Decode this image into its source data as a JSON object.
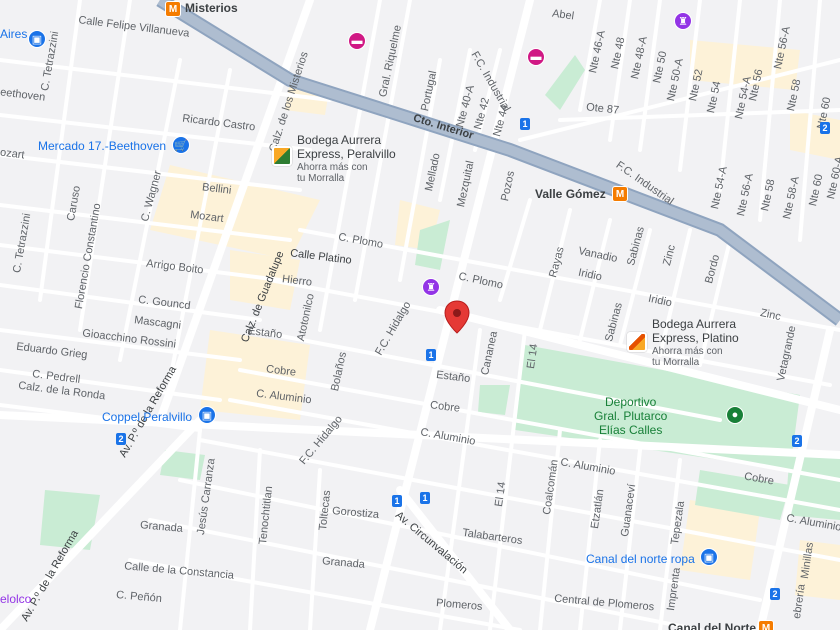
{
  "colors": {
    "background": "#f2f2f4",
    "block": "#fdf2d8",
    "park": "#c9ecd4",
    "road": "#ffffff",
    "highway": "#aebdd0",
    "pin": "#e53935",
    "metro": "#f57c00",
    "shield": "#1a73e8",
    "shopping": "#1a73e8",
    "hotel": "#d01884",
    "monument": "#9334e6",
    "park_icon": "#188038"
  },
  "places": {
    "misterios": "Misterios",
    "valle_gomez": "Valle Gómez",
    "mercado": "Mercado 17.-Beethoven",
    "bodega_peralvillo": [
      "Bodega Aurrera",
      "Express, Peralvillo"
    ],
    "bodega_peralvillo_sub": [
      "Ahorra más con",
      "tu Morralla"
    ],
    "bodega_platino": [
      "Bodega Aurrera",
      "Express, Platino"
    ],
    "bodega_platino_sub": [
      "Ahorra más con",
      "tu Morralla"
    ],
    "deportivo": [
      "Deportivo",
      "Gral. Plutarco",
      "Elías Calles"
    ],
    "coppel": "Coppel Peralvillo",
    "canal_norte_ropa": "Canal del norte ropa",
    "canal_del_norte": "Canal del Norte",
    "aires": "Aires",
    "belolco": "elolco"
  },
  "streets": {
    "felipe_villanueva": "Calle Felipe Villanueva",
    "tetrazzini_top": "C. Tetrazzini",
    "beethoven": "eethoven",
    "mozart_left": "ozart",
    "ricardo_castro": "Ricardo Castro",
    "calz_misterios": "Calz. de los Misterios",
    "gral_riquelme": "Gral. Riquelme",
    "portugal": "Portugal",
    "fc_industrial_top": "F.C. Industrial",
    "nte_40a": "Nte 40-A",
    "nte_42": "Nte 42",
    "nte_44": "Nte 44",
    "nte_46a": "Nte 46-A",
    "nte_48": "Nte 48",
    "nte_48a": "Nte 48-A",
    "nte_50": "Nte 50",
    "nte_50a": "Nte 50-A",
    "nte_52": "Nte 52",
    "nte_54": "Nte 54",
    "nte_54a": "Nte 54-A",
    "nte_56": "Nte 56",
    "nte_56a": "Nte 56-A",
    "nte_58": "Nte 58",
    "nte_58a": "Nte 58-A",
    "nte_60": "Nte 60",
    "nte_60a": "Nte 60-A",
    "nte_54a_low": "Nte 54-A",
    "nte_56a_low": "Nte 56-A",
    "nte_58_low": "Nte 58",
    "nte_60_low": "Nte 60",
    "ote_87": "Ote 87",
    "abel": "Abel",
    "cto_interior": "Cto. Interior",
    "fc_industrial_mid": "F.C. Industrial",
    "mellado": "Mellado",
    "mezquital": "Mezquital",
    "pozos": "Pozos",
    "bellini": "Bellini",
    "mozart": "Mozart",
    "caruso": "Caruso",
    "c_wagner": "C. Wagner",
    "c_tetrazzini": "C. Tetrazzini",
    "florencio": "Florencio Constantino",
    "arrigo_boito": "Arrigo Boito",
    "calle_platino": "Calle Platino",
    "c_plomo_1": "C. Plomo",
    "c_plomo_2": "C. Plomo",
    "hierro": "Hierro",
    "rayas": "Rayas",
    "vanadio": "Vanadio",
    "sabinas_top": "Sabinas",
    "iridio_1": "Iridio",
    "iridio_2": "Iridio",
    "zinc_1": "Zinc",
    "zinc_2": "Zinc",
    "bordo": "Bordo",
    "calz_guadalupe": "Calz. de Guadalupe",
    "c_gouncd": "C. Gouncd",
    "mascagni": "Mascagni",
    "gioacchino": "Gioacchino Rossini",
    "eduardo_grieg": "Eduardo Grieg",
    "c_pedrell": "C. Pedrell",
    "calz_ronda": "Calz. de la Ronda",
    "atotonilco": "Atotonilco",
    "estano_1": "Estaño",
    "estano_2": "Estaño",
    "cobre_1": "Cobre",
    "cobre_2": "Cobre",
    "cobre_3": "Cobre",
    "c_aluminio_1": "C. Aluminio",
    "c_aluminio_2": "C. Aluminio",
    "c_aluminio_3": "C. Aluminio",
    "c_aluminio_4": "C. Aluminio",
    "bolanos": "Bolaños",
    "fc_hidalgo_1": "F.C. Hidalgo",
    "fc_hidalgo_2": "F.C. Hidalgo",
    "cananea": "Cananea",
    "el14_1": "El 14",
    "el14_2": "El 14",
    "sabinas": "Sabinas",
    "vetagrande": "Vetagrande",
    "coalcoman": "Coalcomán",
    "etzatlan": "Etzatlán",
    "guanacevi": "Guanaceví",
    "tepezala": "Tepezala",
    "imprenta": "Imprenta",
    "minillas": "Minillas",
    "febreria": "ebrería",
    "reforma_1": "Av. P.º de la Reforma",
    "reforma_2": "Av. P.º de la Reforma",
    "jesus_carranza": "Jesús Carranza",
    "tenochtitlan": "Tenochtitlan",
    "toltecas": "Toltecas",
    "granada_1": "Granada",
    "granada_2": "Granada",
    "gorostiza": "Gorostiza",
    "av_circunvalacion": "Av. Circunvalación",
    "talabarteros": "Talabarteros",
    "calle_constancia": "Calle de la Constancia",
    "c_penon": "C. Peñón",
    "plomeros": "Plomeros",
    "central_plomeros": "Central de Plomeros"
  },
  "shields": [
    "1",
    "1",
    "1",
    "1",
    "2",
    "2",
    "2",
    "2"
  ],
  "icons": {
    "metro": "M",
    "shopping": "cart-icon",
    "hotel": "bed-icon",
    "monument": "landmark-icon",
    "park": "tree-icon",
    "store": "store-logo-icon",
    "pin": "map-pin-icon"
  }
}
